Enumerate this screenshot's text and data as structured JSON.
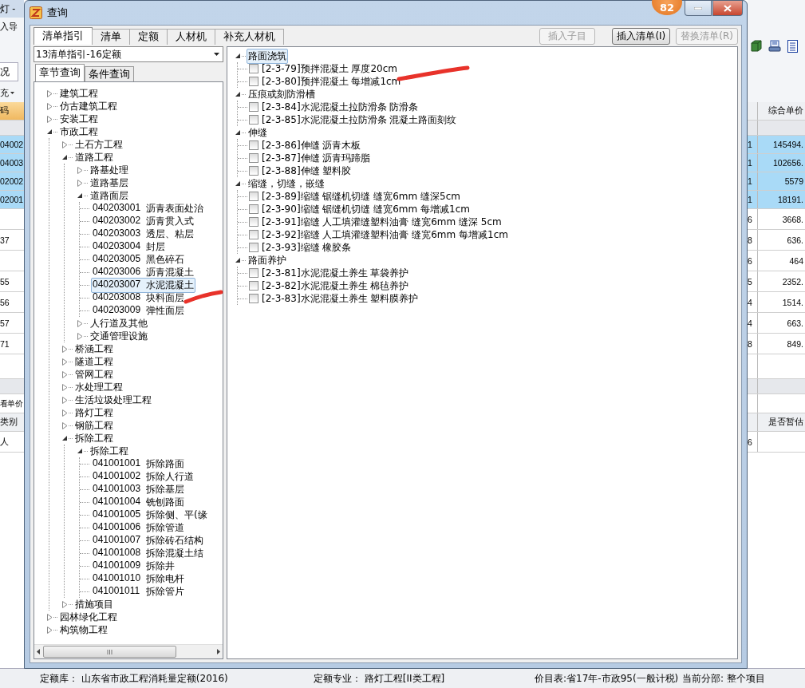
{
  "background": {
    "title": "灯 -",
    "toolbar_text": "入导",
    "tab": "况",
    "dropdown": "充",
    "rows": [
      {
        "kind": "header",
        "code": "码",
        "value": "综合单价"
      },
      {
        "kind": "band"
      },
      {
        "kind": "selected",
        "code": "04002",
        "qty": "1",
        "value": "145494."
      },
      {
        "kind": "selected",
        "code": "04003",
        "qty": "1",
        "value": "102656."
      },
      {
        "kind": "selected",
        "code": "02002",
        "qty": "1",
        "value": "5579"
      },
      {
        "kind": "selected",
        "code": "02001",
        "qty": "1",
        "value": "18191."
      },
      {
        "kind": "row",
        "qty": "6",
        "value": "3668."
      },
      {
        "kind": "row",
        "code": "37",
        "qty": "8",
        "value": "636."
      },
      {
        "kind": "row",
        "qty": "6",
        "value": "464"
      },
      {
        "kind": "row",
        "code": "55",
        "qty": "5",
        "value": "2352."
      },
      {
        "kind": "row",
        "code": "56",
        "qty": "4",
        "value": "1514."
      },
      {
        "kind": "row",
        "code": "57",
        "qty": "4",
        "value": "663."
      },
      {
        "kind": "row",
        "code": "71",
        "qty": "8",
        "value": "849."
      },
      {
        "kind": "blank"
      },
      {
        "kind": "band"
      },
      {
        "kind": "label",
        "code": "看单价"
      },
      {
        "kind": "subheader",
        "code": "类别",
        "value": "是否暂估"
      },
      {
        "kind": "row",
        "code": "人",
        "qty": "6"
      }
    ]
  },
  "dialog": {
    "title": "查询",
    "badge": "82",
    "tabs": [
      {
        "label": "清单指引",
        "selected": true
      },
      {
        "label": "清单",
        "selected": false
      },
      {
        "label": "定额",
        "selected": false
      },
      {
        "label": "人材机",
        "selected": false
      },
      {
        "label": "补充人材机",
        "selected": false
      }
    ],
    "buttons": [
      {
        "label": "插入子目",
        "disabled": true
      },
      {
        "label": "插入清单(I)",
        "disabled": false
      },
      {
        "label": "替换清单(R)",
        "disabled": true
      }
    ],
    "library_select": "13清单指引-16定额",
    "search_tabs": [
      {
        "label": "章节查询",
        "selected": true
      },
      {
        "label": "条件查询",
        "selected": false
      }
    ],
    "tree": [
      {
        "label": "建筑工程",
        "expanded": false,
        "selected": false
      },
      {
        "label": "仿古建筑工程",
        "expanded": false,
        "selected": false
      },
      {
        "label": "安装工程",
        "expanded": false,
        "selected": false
      },
      {
        "label": "市政工程",
        "expanded": true,
        "selected": false,
        "children": [
          {
            "label": "土石方工程",
            "expanded": false,
            "selected": false
          },
          {
            "label": "道路工程",
            "expanded": true,
            "selected": false,
            "children": [
              {
                "label": "路基处理",
                "expanded": false,
                "selected": false
              },
              {
                "label": "道路基层",
                "expanded": false,
                "selected": false
              },
              {
                "label": "道路面层",
                "expanded": true,
                "selected": false,
                "children": [
                  {
                    "code": "040203001",
                    "name": "沥青表面处治",
                    "selected": false
                  },
                  {
                    "code": "040203002",
                    "name": "沥青贯入式",
                    "selected": false
                  },
                  {
                    "code": "040203003",
                    "name": "透层、粘层",
                    "selected": false
                  },
                  {
                    "code": "040203004",
                    "name": "封层",
                    "selected": false
                  },
                  {
                    "code": "040203005",
                    "name": "黑色碎石",
                    "selected": false
                  },
                  {
                    "code": "040203006",
                    "name": "沥青混凝土",
                    "selected": false
                  },
                  {
                    "code": "040203007",
                    "name": "水泥混凝土",
                    "selected": true
                  },
                  {
                    "code": "040203008",
                    "name": "块料面层",
                    "selected": false
                  },
                  {
                    "code": "040203009",
                    "name": "弹性面层",
                    "selected": false
                  }
                ]
              },
              {
                "label": "人行道及其他",
                "expanded": false,
                "selected": false
              },
              {
                "label": "交通管理设施",
                "expanded": false,
                "selected": false
              }
            ]
          },
          {
            "label": "桥涵工程",
            "expanded": false,
            "selected": false
          },
          {
            "label": "隧道工程",
            "expanded": false,
            "selected": false
          },
          {
            "label": "管网工程",
            "expanded": false,
            "selected": false
          },
          {
            "label": "水处理工程",
            "expanded": false,
            "selected": false
          },
          {
            "label": "生活垃圾处理工程",
            "expanded": false,
            "selected": false
          },
          {
            "label": "路灯工程",
            "expanded": false,
            "selected": false
          },
          {
            "label": "钢筋工程",
            "expanded": false,
            "selected": false
          },
          {
            "label": "拆除工程",
            "expanded": true,
            "selected": false,
            "children": [
              {
                "label": "拆除工程",
                "expanded": true,
                "selected": false,
                "children": [
                  {
                    "code": "041001001",
                    "name": "拆除路面",
                    "selected": false
                  },
                  {
                    "code": "041001002",
                    "name": "拆除人行道",
                    "selected": false
                  },
                  {
                    "code": "041001003",
                    "name": "拆除基层",
                    "selected": false
                  },
                  {
                    "code": "041001004",
                    "name": "铣刨路面",
                    "selected": false
                  },
                  {
                    "code": "041001005",
                    "name": "拆除侧、平(缘",
                    "selected": false
                  },
                  {
                    "code": "041001006",
                    "name": "拆除管道",
                    "selected": false
                  },
                  {
                    "code": "041001007",
                    "name": "拆除砖石结构",
                    "selected": false
                  },
                  {
                    "code": "041001008",
                    "name": "拆除混凝土结",
                    "selected": false
                  },
                  {
                    "code": "041001009",
                    "name": "拆除井",
                    "selected": false
                  },
                  {
                    "code": "041001010",
                    "name": "拆除电杆",
                    "selected": false
                  },
                  {
                    "code": "041001011",
                    "name": "拆除管片",
                    "selected": false
                  }
                ]
              }
            ]
          },
          {
            "label": "措施项目",
            "expanded": false,
            "selected": false
          }
        ]
      },
      {
        "label": "园林绿化工程",
        "expanded": false,
        "selected": false
      },
      {
        "label": "构筑物工程",
        "expanded": false,
        "selected": false
      }
    ],
    "groups": [
      {
        "label": "路面浇筑",
        "expanded": true,
        "selected": true,
        "items": [
          {
            "label": "[2-3-79]预拌混凝土 厚度20cm",
            "checked": false
          },
          {
            "label": "[2-3-80]预拌混凝土 每增减1cm",
            "checked": false
          }
        ]
      },
      {
        "label": "压痕或刻防滑槽",
        "expanded": true,
        "selected": false,
        "items": [
          {
            "label": "[2-3-84]水泥混凝土拉防滑条 防滑条",
            "checked": false
          },
          {
            "label": "[2-3-85]水泥混凝土拉防滑条 混凝土路面刻纹",
            "checked": false
          }
        ]
      },
      {
        "label": "伸缝",
        "expanded": true,
        "selected": false,
        "items": [
          {
            "label": "[2-3-86]伸缝 沥青木板",
            "checked": false
          },
          {
            "label": "[2-3-87]伸缝 沥青玛蹄脂",
            "checked": false
          },
          {
            "label": "[2-3-88]伸缝 塑料胶",
            "checked": false
          }
        ]
      },
      {
        "label": "缩缝，切缝，嵌缝",
        "expanded": true,
        "selected": false,
        "items": [
          {
            "label": "[2-3-89]缩缝 锯缝机切缝 缝宽6mm 缝深5cm",
            "checked": false
          },
          {
            "label": "[2-3-90]缩缝 锯缝机切缝 缝宽6mm 每增减1cm",
            "checked": false
          },
          {
            "label": "[2-3-91]缩缝 人工填灌缝塑料油膏 缝宽6mm 缝深 5cm",
            "checked": false
          },
          {
            "label": "[2-3-92]缩缝 人工填灌缝塑料油膏 缝宽6mm 每增减1cm",
            "checked": false
          },
          {
            "label": "[2-3-93]缩缝 橡胶条",
            "checked": false
          }
        ]
      },
      {
        "label": "路面养护",
        "expanded": true,
        "selected": false,
        "items": [
          {
            "label": "[2-3-81]水泥混凝土养生 草袋养护",
            "checked": false
          },
          {
            "label": "[2-3-82]水泥混凝土养生 棉毡养护",
            "checked": false
          },
          {
            "label": "[2-3-83]水泥混凝土养生 塑料膜养护",
            "checked": false
          }
        ]
      }
    ]
  },
  "status_bar": [
    "定额库： 山东省市政工程消耗量定额(2016)",
    "定额专业： 路灯工程[II类工程]",
    "价目表:省17年-市政95(一般计税)",
    "当前分部: 整个项目"
  ]
}
